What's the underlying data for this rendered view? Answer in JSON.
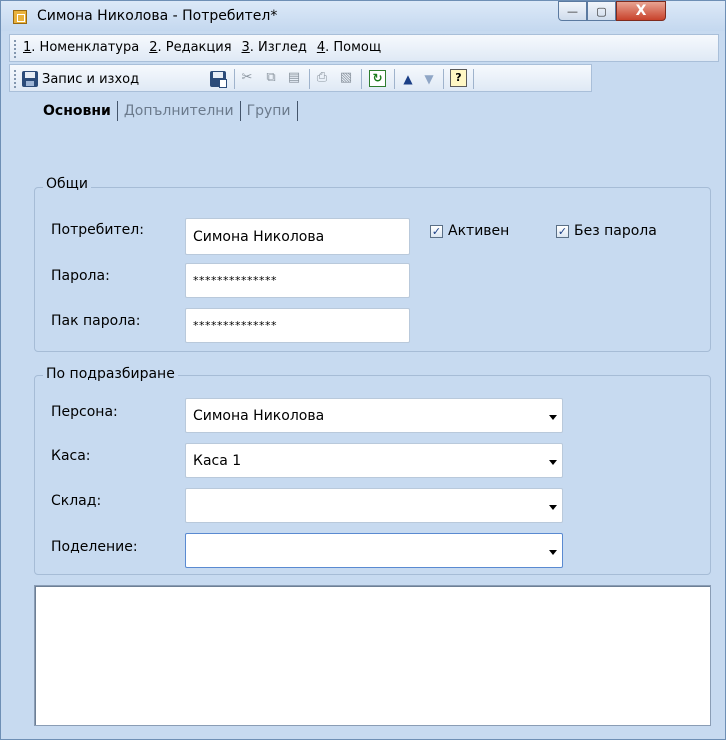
{
  "window": {
    "title": "Симона Николова - Потребител*",
    "controls": {
      "minimize": "—",
      "maximize": "▢",
      "close": "X"
    }
  },
  "menu": {
    "items": [
      {
        "num": "1",
        "rest": ". Номенклатура"
      },
      {
        "num": "2",
        "rest": ". Редакция"
      },
      {
        "num": "3",
        "rest": ". Изглед"
      },
      {
        "num": "4",
        "rest": ". Помощ"
      }
    ]
  },
  "toolbar": {
    "save_exit_label": "Запис и изход"
  },
  "tabs": {
    "items": [
      "Основни",
      "Допълнителни",
      "Групи"
    ],
    "active_index": 0
  },
  "general": {
    "label": "Общи",
    "user_label": "Потребител:",
    "user_value": "Симона Николова",
    "password_label": "Парола:",
    "password_value": "**************",
    "repeat_label": "Пак парола:",
    "repeat_value": "**************",
    "active_label": "Активен",
    "active_checked": true,
    "no_password_label": "Без парола",
    "no_password_checked": true
  },
  "defaults": {
    "label": "По подразбиране",
    "persona_label": "Персона:",
    "persona_value": "Симона Николова",
    "cash_label": "Каса:",
    "cash_value": "Каса 1",
    "warehouse_label": "Склад:",
    "warehouse_value": "",
    "division_label": "Поделение:",
    "division_value": ""
  },
  "colors": {
    "background": "#c7daf0",
    "accent": "#1b3f86",
    "close_button": "#c8422b"
  }
}
